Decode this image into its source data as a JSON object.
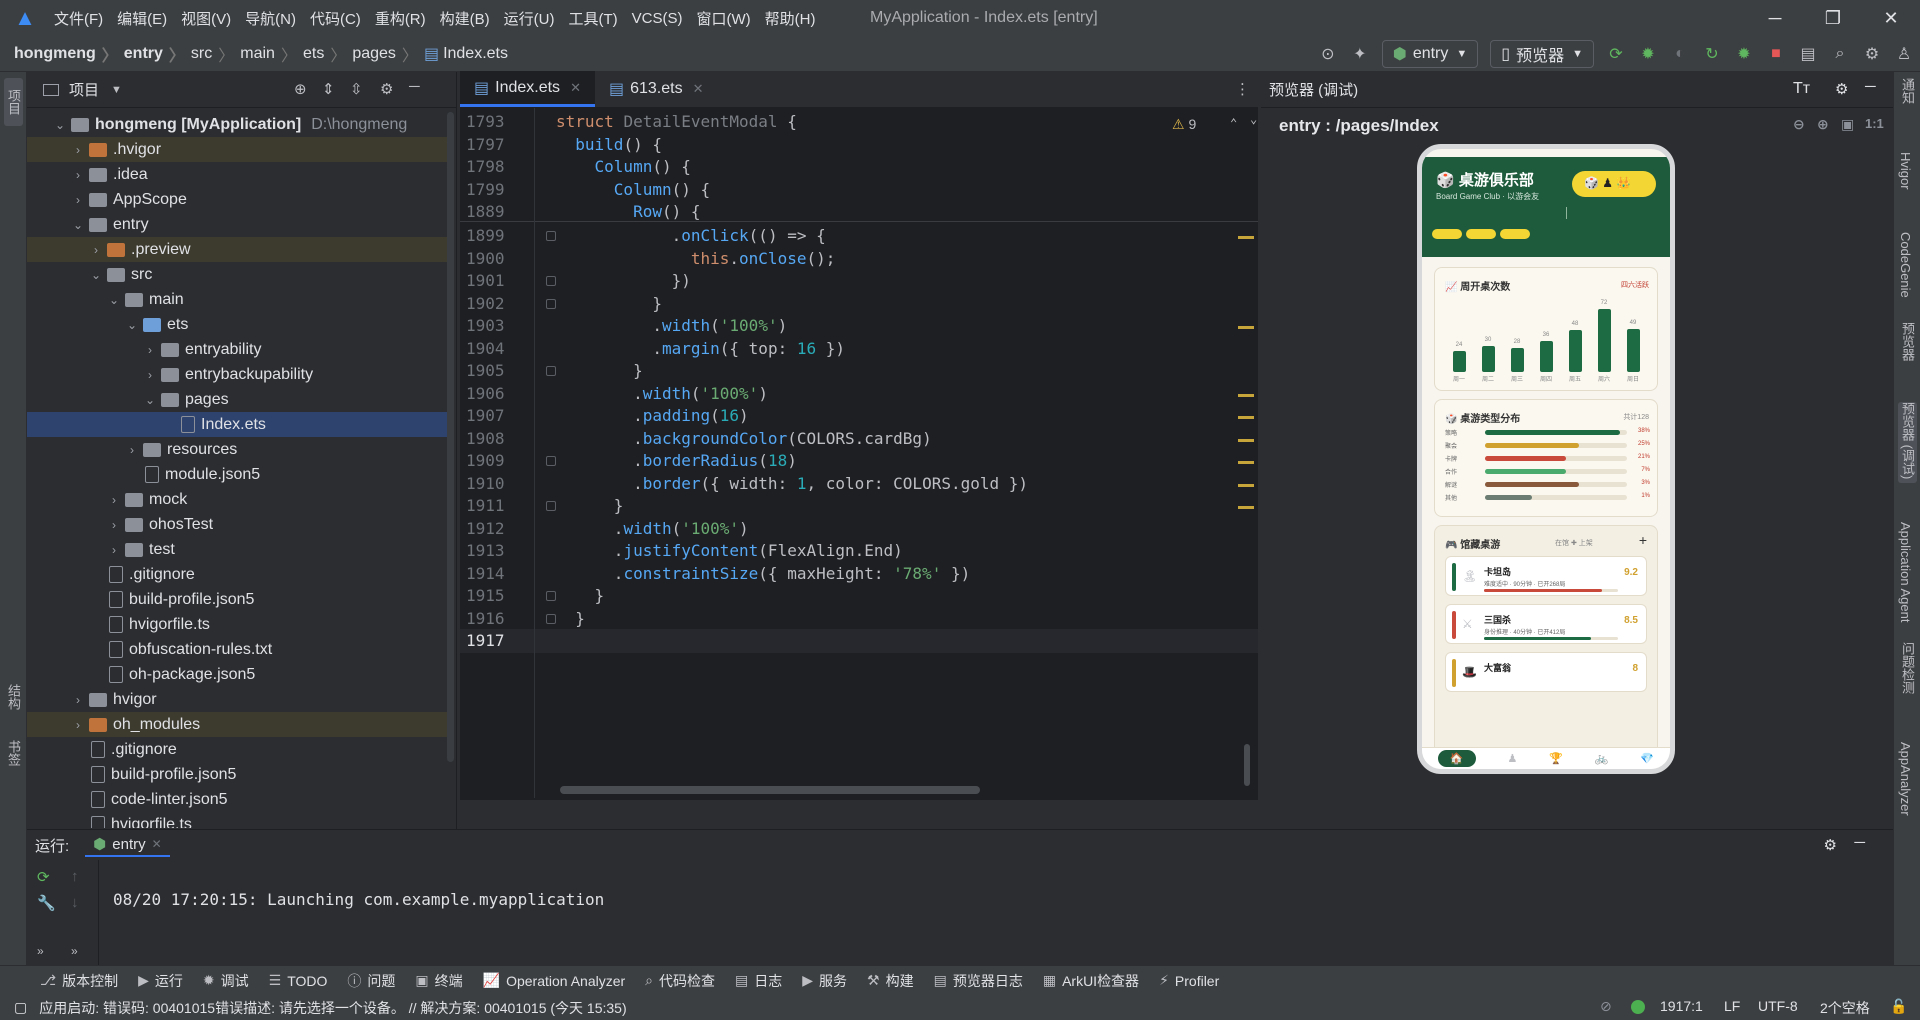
{
  "titlebar": {
    "menus": [
      "文件(F)",
      "编辑(E)",
      "视图(V)",
      "导航(N)",
      "代码(C)",
      "重构(R)",
      "构建(B)",
      "运行(U)",
      "工具(T)",
      "VCS(S)",
      "窗口(W)",
      "帮助(H)"
    ],
    "title": "MyApplication - Index.ets [entry]"
  },
  "breadcrumb": [
    "hongmeng",
    "entry",
    "src",
    "main",
    "ets",
    "pages",
    "Index.ets"
  ],
  "toolbar": {
    "module": "entry",
    "device": "预览器"
  },
  "project": {
    "title": "项目",
    "root_name": "hongmeng [MyApplication]",
    "root_path": "D:\\hongmeng",
    "items": [
      {
        "name": ".hvigor",
        "depth": 1,
        "kind": "folder-orange",
        "arrow": "›"
      },
      {
        "name": ".idea",
        "depth": 1,
        "kind": "folder",
        "arrow": "›"
      },
      {
        "name": "AppScope",
        "depth": 1,
        "kind": "folder",
        "arrow": "›"
      },
      {
        "name": "entry",
        "depth": 1,
        "kind": "folder",
        "arrow": "⌄"
      },
      {
        "name": ".preview",
        "depth": 2,
        "kind": "folder-orange",
        "arrow": "›"
      },
      {
        "name": "src",
        "depth": 2,
        "kind": "folder",
        "arrow": "⌄"
      },
      {
        "name": "main",
        "depth": 3,
        "kind": "folder",
        "arrow": "⌄"
      },
      {
        "name": "ets",
        "depth": 4,
        "kind": "folder-blue",
        "arrow": "⌄"
      },
      {
        "name": "entryability",
        "depth": 5,
        "kind": "folder",
        "arrow": "›"
      },
      {
        "name": "entrybackupability",
        "depth": 5,
        "kind": "folder",
        "arrow": "›"
      },
      {
        "name": "pages",
        "depth": 5,
        "kind": "folder",
        "arrow": "⌄"
      },
      {
        "name": "Index.ets",
        "depth": 6,
        "kind": "file",
        "arrow": ""
      },
      {
        "name": "resources",
        "depth": 4,
        "kind": "folder",
        "arrow": "›"
      },
      {
        "name": "module.json5",
        "depth": 4,
        "kind": "file",
        "arrow": ""
      },
      {
        "name": "mock",
        "depth": 3,
        "kind": "folder",
        "arrow": "›"
      },
      {
        "name": "ohosTest",
        "depth": 3,
        "kind": "folder",
        "arrow": "›"
      },
      {
        "name": "test",
        "depth": 3,
        "kind": "folder",
        "arrow": "›"
      },
      {
        "name": ".gitignore",
        "depth": 2,
        "kind": "file",
        "arrow": ""
      },
      {
        "name": "build-profile.json5",
        "depth": 2,
        "kind": "file",
        "arrow": ""
      },
      {
        "name": "hvigorfile.ts",
        "depth": 2,
        "kind": "file",
        "arrow": ""
      },
      {
        "name": "obfuscation-rules.txt",
        "depth": 2,
        "kind": "file",
        "arrow": ""
      },
      {
        "name": "oh-package.json5",
        "depth": 2,
        "kind": "file",
        "arrow": ""
      },
      {
        "name": "hvigor",
        "depth": 1,
        "kind": "folder",
        "arrow": "›"
      },
      {
        "name": "oh_modules",
        "depth": 1,
        "kind": "folder-orange",
        "arrow": "›"
      },
      {
        "name": ".gitignore",
        "depth": 1,
        "kind": "file",
        "arrow": ""
      },
      {
        "name": "build-profile.json5",
        "depth": 1,
        "kind": "file",
        "arrow": ""
      },
      {
        "name": "code-linter.json5",
        "depth": 1,
        "kind": "file",
        "arrow": ""
      },
      {
        "name": "hvigorfile.ts",
        "depth": 1,
        "kind": "file",
        "arrow": ""
      }
    ]
  },
  "editor": {
    "tabs": [
      "Index.ets",
      "613.ets"
    ],
    "warnings": "9",
    "sticky": [
      {
        "ln": "1793",
        "html": "<span class='kw'>struct</span> <span class='gray'>DetailEventModal</span> {"
      },
      {
        "ln": "1797",
        "html": "  <span class='fn'>build</span>() {"
      },
      {
        "ln": "1798",
        "html": "    <span class='fn'>Column</span>() {"
      },
      {
        "ln": "1799",
        "html": "      <span class='fn'>Column</span>() {"
      },
      {
        "ln": "1889",
        "html": "        <span class='fn'>Row</span>() {"
      }
    ],
    "lines": [
      {
        "ln": "1899",
        "html": "            .<span class='fn'>onClick</span>(() => {"
      },
      {
        "ln": "1900",
        "html": "              <span class='kw'>this</span>.<span class='fn'>onClose</span>();"
      },
      {
        "ln": "1901",
        "html": "            })"
      },
      {
        "ln": "1902",
        "html": "          }"
      },
      {
        "ln": "1903",
        "html": "          .<span class='fn'>width</span>(<span class='st'>'100%'</span>)"
      },
      {
        "ln": "1904",
        "html": "          .<span class='fn'>margin</span>({ <span class='cls'>top</span>: <span class='nm'>16</span> })"
      },
      {
        "ln": "1905",
        "html": "        }"
      },
      {
        "ln": "1906",
        "html": "        .<span class='fn'>width</span>(<span class='st'>'100%'</span>)"
      },
      {
        "ln": "1907",
        "html": "        .<span class='fn'>padding</span>(<span class='nm'>16</span>)"
      },
      {
        "ln": "1908",
        "html": "        .<span class='fn'>backgroundColor</span>(COLORS.cardBg)"
      },
      {
        "ln": "1909",
        "html": "        .<span class='fn'>borderRadius</span>(<span class='nm'>18</span>)"
      },
      {
        "ln": "1910",
        "html": "        .<span class='fn'>border</span>({ width: <span class='nm'>1</span>, color: COLORS.gold })"
      },
      {
        "ln": "1911",
        "html": "      }"
      },
      {
        "ln": "1912",
        "html": "      .<span class='fn'>width</span>(<span class='st'>'100%'</span>)"
      },
      {
        "ln": "1913",
        "html": "      .<span class='fn'>justifyContent</span>(FlexAlign.End)"
      },
      {
        "ln": "1914",
        "html": "      .<span class='fn'>constraintSize</span>({ maxHeight: <span class='st'>'78%'</span> })"
      },
      {
        "ln": "1915",
        "html": "    }"
      },
      {
        "ln": "1916",
        "html": "  }"
      },
      {
        "ln": "1917",
        "html": ""
      }
    ]
  },
  "preview": {
    "header": "预览器 (调试)",
    "path": "entry : /pages/Index",
    "app": {
      "title": "桌游俱乐部",
      "subtitle": "Board Game Club · 以游会友",
      "weekly_title": "周开桌次数",
      "weekly_link": "四六活跃",
      "dist_title": "桌游类型分布",
      "dist_total": "共计128",
      "library_title": "馆藏桌游",
      "library_meta": "在馆 ✚ 上架",
      "tabs": [
        "🏠",
        "♟",
        "🏆",
        "🚲",
        "💎"
      ]
    }
  },
  "chart_data": {
    "type": "bar",
    "categories": [
      "周一",
      "周二",
      "周三",
      "周四",
      "周五",
      "周六",
      "周日"
    ],
    "values": [
      24,
      30,
      28,
      36,
      48,
      72,
      49
    ],
    "title": "周开桌次数",
    "xlabel": "",
    "ylabel": "",
    "ylim": [
      0,
      80
    ]
  },
  "distribution": [
    {
      "label": "策略",
      "pct": "38%",
      "fill": 0.95,
      "color": "#1d6b43"
    },
    {
      "label": "聚会",
      "pct": "25%",
      "fill": 0.66,
      "color": "#d1a12f"
    },
    {
      "label": "卡牌",
      "pct": "21%",
      "fill": 0.57,
      "color": "#c94a3a"
    },
    {
      "label": "合作",
      "pct": "7%",
      "fill": 0.57,
      "color": "#4aa96c"
    },
    {
      "label": "解谜",
      "pct": "3%",
      "fill": 0.66,
      "color": "#8a5a3c"
    },
    {
      "label": "其他",
      "pct": "1%",
      "fill": 0.33,
      "color": "#6b7d72"
    }
  ],
  "games": [
    {
      "name": "卡坦岛",
      "desc": "难度适中 · 90分钟 · 已开268局",
      "score": "9.2",
      "color": "#1d6b43",
      "progress": 0.88,
      "pcolor": "#c94a3a"
    },
    {
      "name": "三国杀",
      "desc": "身份推理 · 40分钟 · 已开412局",
      "score": "8.5",
      "color": "#c94a3a",
      "progress": 0.8,
      "pcolor": "#1d6b43"
    },
    {
      "name": "大富翁",
      "desc": "",
      "score": "8",
      "color": "#d1a12f",
      "progress": 0,
      "pcolor": "#1d6b43"
    }
  ],
  "run": {
    "label": "运行:",
    "config": "entry",
    "output": "08/20 17:20:15: Launching com.example.myapplication"
  },
  "toolstrip": [
    "版本控制",
    "运行",
    "调试",
    "TODO",
    "问题",
    "终端",
    "Operation Analyzer",
    "代码检查",
    "日志",
    "服务",
    "构建",
    "预览器日志",
    "ArkUI检查器",
    "Profiler"
  ],
  "status": {
    "message": "应用启动: 错误码: 00401015错误描述: 请先选择一个设备。 // 解决方案: 00401015 (今天 15:35)",
    "position": "1917:1",
    "lf": "LF",
    "encoding": "UTF-8",
    "indent": "2个空格"
  },
  "left_stripe": [
    "项目",
    "结构",
    "书签"
  ],
  "right_stripe": [
    "通知",
    "Hvigor",
    "CodeGenie",
    "预览器",
    "预览器 (调试)",
    "Application Agent",
    "问题检测",
    "AppAnalyzer"
  ]
}
